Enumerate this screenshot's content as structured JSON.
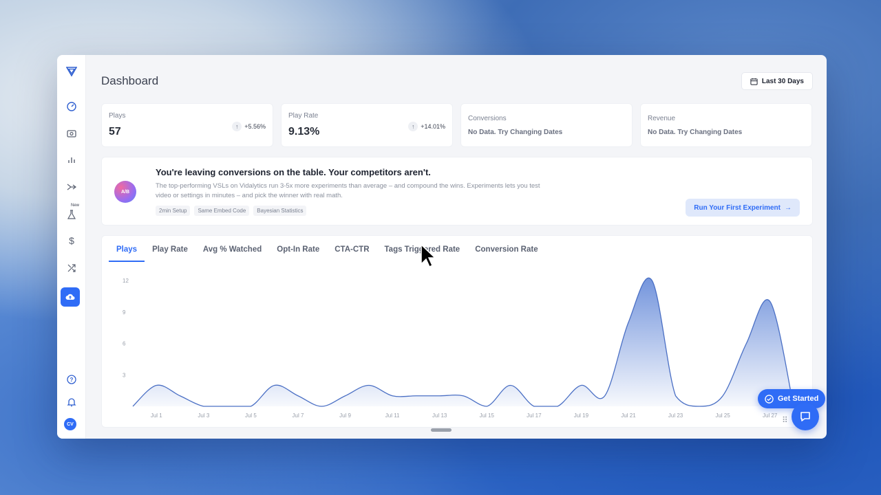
{
  "sidebar": {
    "new_badge": "New",
    "avatar_initials": "CV"
  },
  "header": {
    "title": "Dashboard",
    "date_range": "Last 30 Days"
  },
  "stats": [
    {
      "label": "Plays",
      "value": "57",
      "change": "+5.56%"
    },
    {
      "label": "Play Rate",
      "value": "9.13%",
      "change": "+14.01%"
    },
    {
      "label": "Conversions",
      "value": "No Data. Try Changing Dates"
    },
    {
      "label": "Revenue",
      "value": "No Data. Try Changing Dates"
    }
  ],
  "banner": {
    "badge": "A/B",
    "title": "You're leaving conversions on the table. Your competitors aren't.",
    "description": "The top-performing VSLs on Vidalytics run 3-5x more experiments than average – and compound the wins. Experiments lets you test video or settings in minutes – and pick the winner with real math.",
    "tags": [
      "2min Setup",
      "Same Embed Code",
      "Bayesian Statistics"
    ],
    "cta": "Run Your First Experiment"
  },
  "tabs": [
    "Plays",
    "Play Rate",
    "Avg % Watched",
    "Opt-In Rate",
    "CTA-CTR",
    "Tags Triggered Rate",
    "Conversion Rate"
  ],
  "active_tab": "Plays",
  "chart_data": {
    "type": "area",
    "x": [
      "Jun 30",
      "Jul 1",
      "Jul 2",
      "Jul 3",
      "Jul 4",
      "Jul 5",
      "Jul 6",
      "Jul 7",
      "Jul 8",
      "Jul 9",
      "Jul 10",
      "Jul 11",
      "Jul 12",
      "Jul 13",
      "Jul 14",
      "Jul 15",
      "Jul 16",
      "Jul 17",
      "Jul 18",
      "Jul 19",
      "Jul 20",
      "Jul 21",
      "Jul 22",
      "Jul 23",
      "Jul 24",
      "Jul 25",
      "Jul 26",
      "Jul 27",
      "Jul 28"
    ],
    "values": [
      0,
      2,
      1,
      0,
      0,
      0,
      2,
      1,
      0,
      1,
      2,
      1,
      1,
      1,
      1,
      0,
      2,
      0,
      0,
      2,
      1,
      8,
      12,
      1,
      0,
      1,
      6,
      10,
      0
    ],
    "xticks": [
      "Jul 1",
      "Jul 3",
      "Jul 5",
      "Jul 7",
      "Jul 9",
      "Jul 11",
      "Jul 13",
      "Jul 15",
      "Jul 17",
      "Jul 19",
      "Jul 21",
      "Jul 23",
      "Jul 25",
      "Jul 27"
    ],
    "yticks": [
      "3",
      "6",
      "9",
      "12"
    ],
    "ylim": [
      0,
      12
    ],
    "color": "#5b82d6"
  },
  "widgets": {
    "get_started": "Get Started"
  }
}
